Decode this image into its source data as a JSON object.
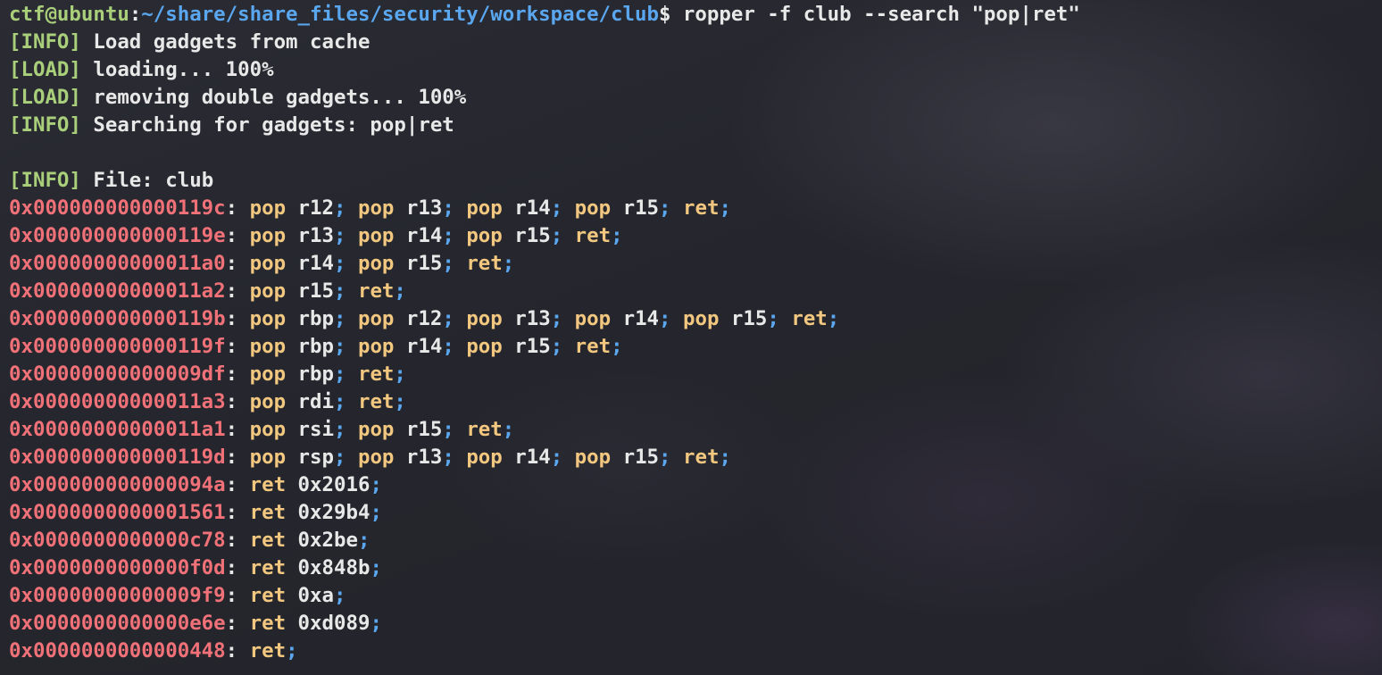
{
  "terminal": {
    "prompt": {
      "user_host": "ctf@ubuntu",
      "colon": ":",
      "path": "~/share/share_files/security/workspace/club",
      "dollar": "$ ",
      "command": "ropper -f club --search \"pop|ret\""
    },
    "info_lines": [
      {
        "tag": "[INFO]",
        "text": " Load gadgets from cache"
      },
      {
        "tag": "[LOAD]",
        "text": " loading... 100%"
      },
      {
        "tag": "[LOAD]",
        "text": " removing double gadgets... 100%"
      },
      {
        "tag": "[INFO]",
        "text": " Searching for gadgets: pop|ret"
      }
    ],
    "file_line": {
      "tag": "[INFO]",
      "text": " File: club"
    },
    "gadgets": [
      {
        "addr": "0x000000000000119c",
        "instrs": [
          [
            "pop",
            "r12"
          ],
          [
            "pop",
            "r13"
          ],
          [
            "pop",
            "r14"
          ],
          [
            "pop",
            "r15"
          ],
          [
            "ret",
            ""
          ]
        ]
      },
      {
        "addr": "0x000000000000119e",
        "instrs": [
          [
            "pop",
            "r13"
          ],
          [
            "pop",
            "r14"
          ],
          [
            "pop",
            "r15"
          ],
          [
            "ret",
            ""
          ]
        ]
      },
      {
        "addr": "0x00000000000011a0",
        "instrs": [
          [
            "pop",
            "r14"
          ],
          [
            "pop",
            "r15"
          ],
          [
            "ret",
            ""
          ]
        ]
      },
      {
        "addr": "0x00000000000011a2",
        "instrs": [
          [
            "pop",
            "r15"
          ],
          [
            "ret",
            ""
          ]
        ]
      },
      {
        "addr": "0x000000000000119b",
        "instrs": [
          [
            "pop",
            "rbp"
          ],
          [
            "pop",
            "r12"
          ],
          [
            "pop",
            "r13"
          ],
          [
            "pop",
            "r14"
          ],
          [
            "pop",
            "r15"
          ],
          [
            "ret",
            ""
          ]
        ]
      },
      {
        "addr": "0x000000000000119f",
        "instrs": [
          [
            "pop",
            "rbp"
          ],
          [
            "pop",
            "r14"
          ],
          [
            "pop",
            "r15"
          ],
          [
            "ret",
            ""
          ]
        ]
      },
      {
        "addr": "0x00000000000009df",
        "instrs": [
          [
            "pop",
            "rbp"
          ],
          [
            "ret",
            ""
          ]
        ]
      },
      {
        "addr": "0x00000000000011a3",
        "instrs": [
          [
            "pop",
            "rdi"
          ],
          [
            "ret",
            ""
          ]
        ]
      },
      {
        "addr": "0x00000000000011a1",
        "instrs": [
          [
            "pop",
            "rsi"
          ],
          [
            "pop",
            "r15"
          ],
          [
            "ret",
            ""
          ]
        ]
      },
      {
        "addr": "0x000000000000119d",
        "instrs": [
          [
            "pop",
            "rsp"
          ],
          [
            "pop",
            "r13"
          ],
          [
            "pop",
            "r14"
          ],
          [
            "pop",
            "r15"
          ],
          [
            "ret",
            ""
          ]
        ]
      },
      {
        "addr": "0x000000000000094a",
        "instrs": [
          [
            "ret",
            "0x2016"
          ]
        ]
      },
      {
        "addr": "0x0000000000001561",
        "instrs": [
          [
            "ret",
            "0x29b4"
          ]
        ]
      },
      {
        "addr": "0x0000000000000c78",
        "instrs": [
          [
            "ret",
            "0x2be"
          ]
        ]
      },
      {
        "addr": "0x0000000000000f0d",
        "instrs": [
          [
            "ret",
            "0x848b"
          ]
        ]
      },
      {
        "addr": "0x00000000000009f9",
        "instrs": [
          [
            "ret",
            "0xa"
          ]
        ]
      },
      {
        "addr": "0x0000000000000e6e",
        "instrs": [
          [
            "ret",
            "0xd089"
          ]
        ]
      },
      {
        "addr": "0x0000000000000448",
        "instrs": [
          [
            "ret",
            ""
          ]
        ]
      }
    ]
  }
}
